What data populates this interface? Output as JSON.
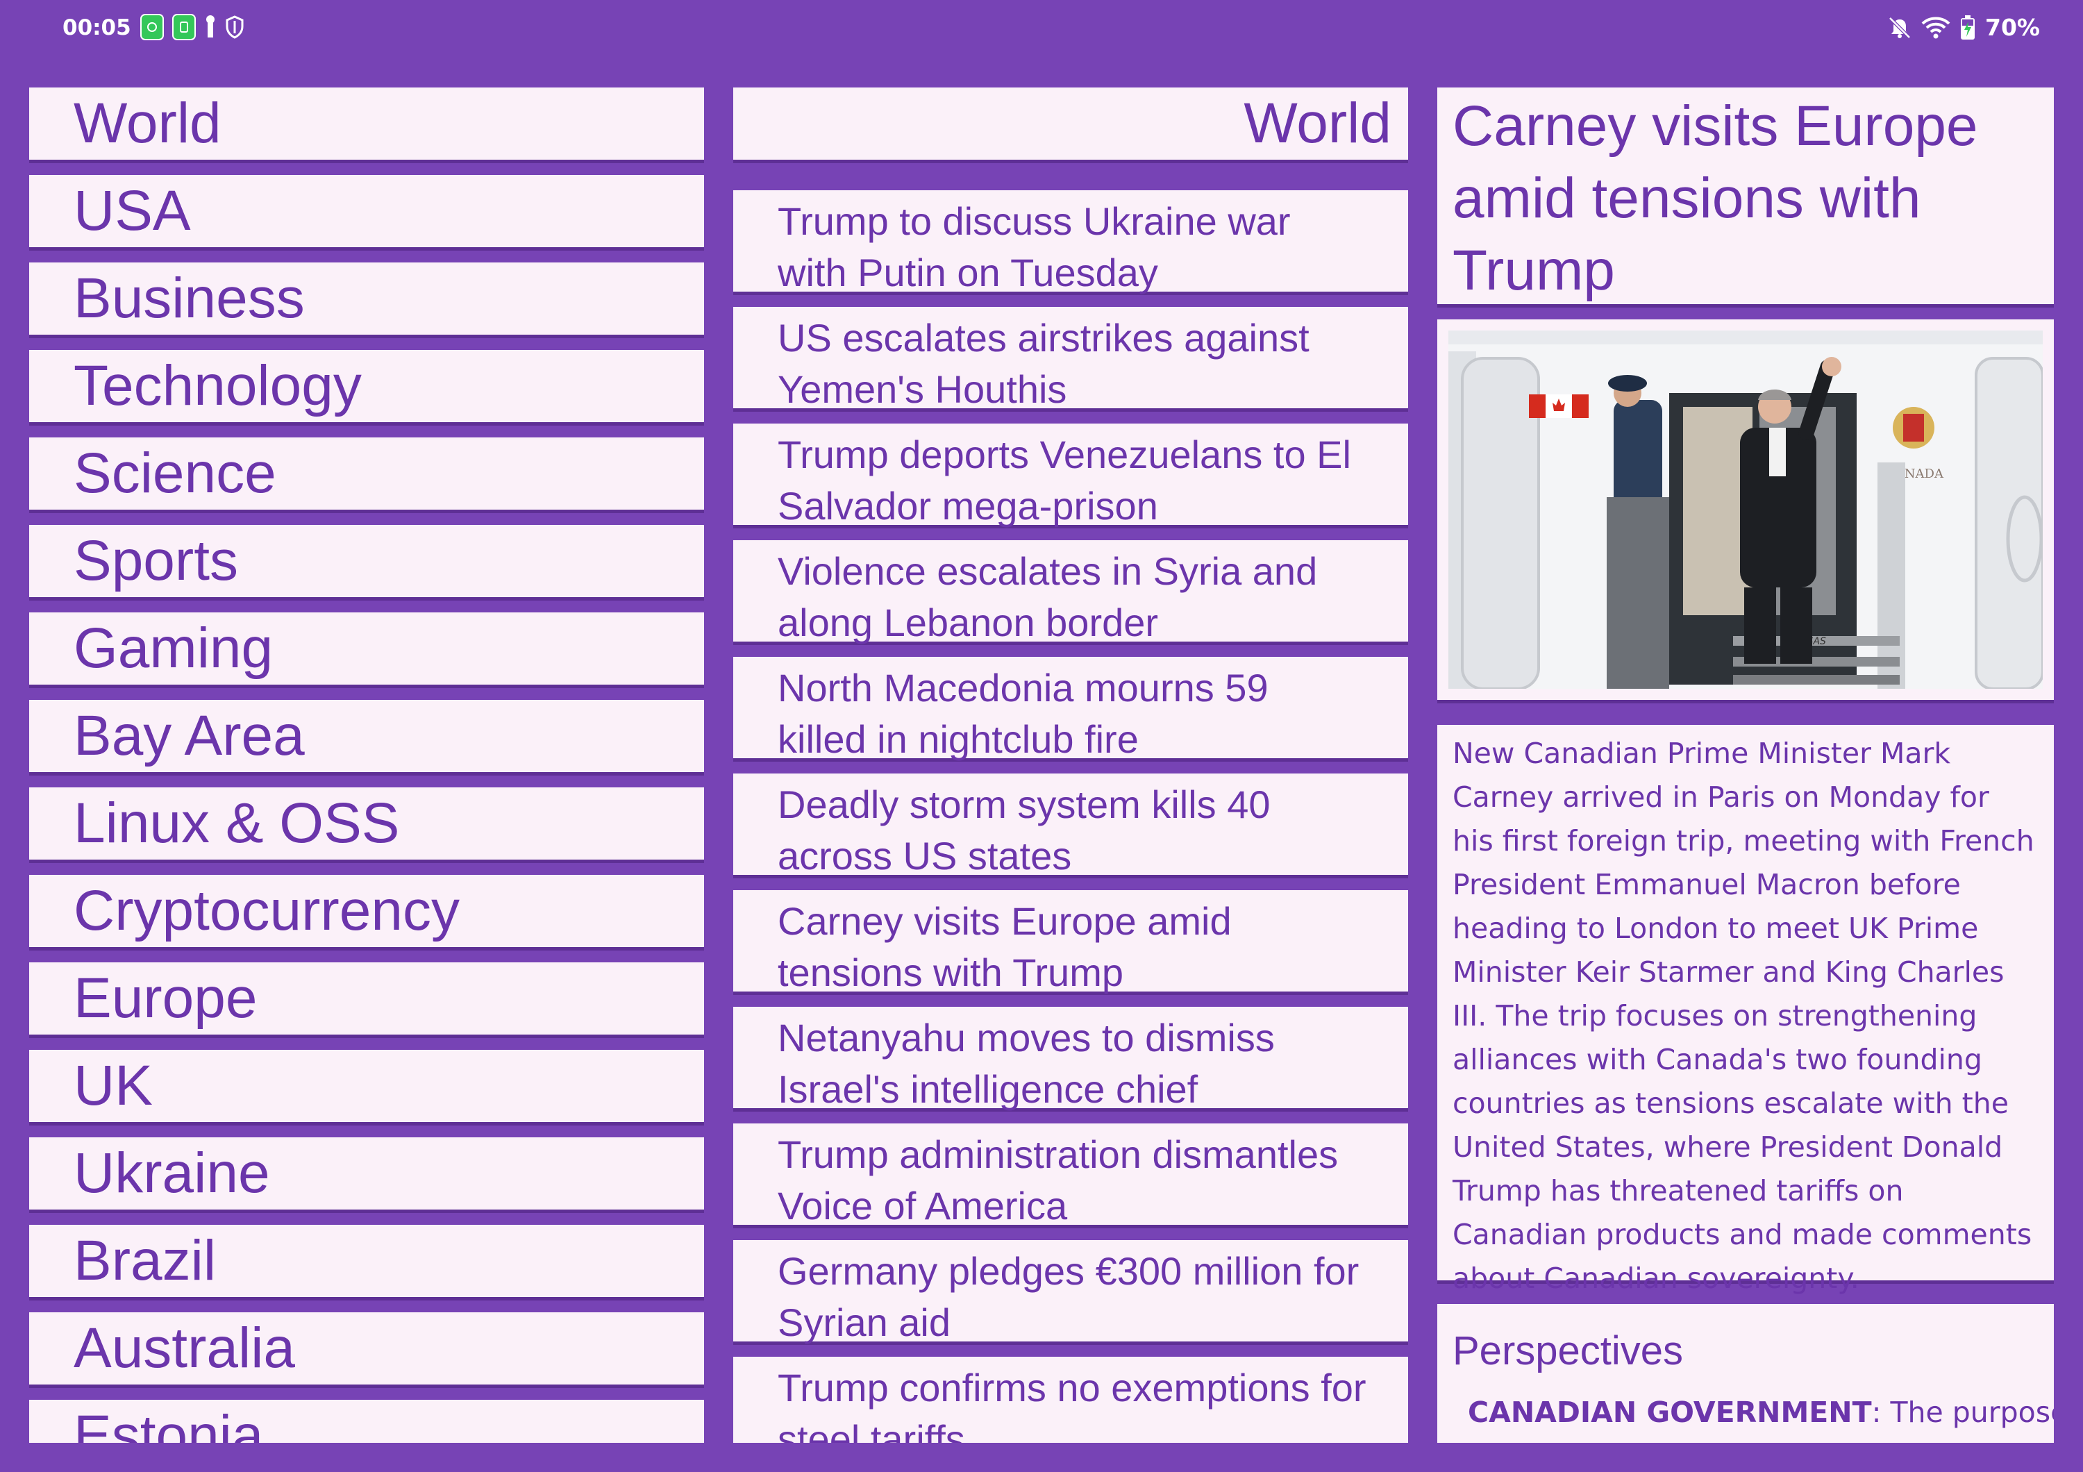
{
  "status_bar": {
    "time": "00:05",
    "battery": "70%",
    "left_icons": [
      "upload-app-icon",
      "sim-app-icon",
      "keyhole-icon",
      "shield-icon"
    ],
    "right_icons": [
      "bell-off-icon",
      "wifi-icon",
      "battery-charging-icon"
    ]
  },
  "nav": {
    "items": [
      "World",
      "USA",
      "Business",
      "Technology",
      "Science",
      "Sports",
      "Gaming",
      "Bay Area",
      "Linux & OSS",
      "Cryptocurrency",
      "Europe",
      "UK",
      "Ukraine",
      "Brazil",
      "Australia",
      "Estonia"
    ]
  },
  "headlines": {
    "category": "World",
    "stories": [
      "Trump to discuss Ukraine war with Putin on Tuesday",
      "US escalates airstrikes against Yemen's Houthis",
      "Trump deports Venezuelans to El Salvador mega-prison",
      "Violence escalates in Syria and along Lebanon border",
      "North Macedonia mourns 59 killed in nightclub fire",
      "Deadly storm system kills 40 across US states",
      "Carney visits Europe amid tensions with Trump",
      "Netanyahu moves to dismiss Israel's intelligence chief",
      "Trump administration dismantles Voice of America",
      "Germany pledges €300 million for Syrian aid",
      "Trump confirms no exemptions for steel tariffs"
    ]
  },
  "detail": {
    "title": "Carney visits Europe amid tensions with Trump",
    "image_alt": "Mark Carney waving from the door of a Canadian government aircraft while an officer salutes",
    "plane_text": "CANADA",
    "stairs_text": "TSAS",
    "summary": "New Canadian Prime Minister Mark Carney arrived in Paris on Monday for his first foreign trip, meeting with French President Emmanuel Macron before heading to London to meet UK Prime Minister Keir Starmer and King Charles III. The trip focuses on strengthening alliances with Canada's two founding countries as tensions escalate with the United States, where President Donald Trump has threatened tariffs on Canadian products and made comments about Canadian sovereignty.",
    "perspectives_title": "Perspectives",
    "perspective_source": "CANADIAN GOVERNMENT",
    "perspective_text": ": The purpose of"
  },
  "colors": {
    "background": "#7743b5",
    "card": "#fbf1f9",
    "text": "#6b35ab",
    "accent_green": "#34c759"
  }
}
